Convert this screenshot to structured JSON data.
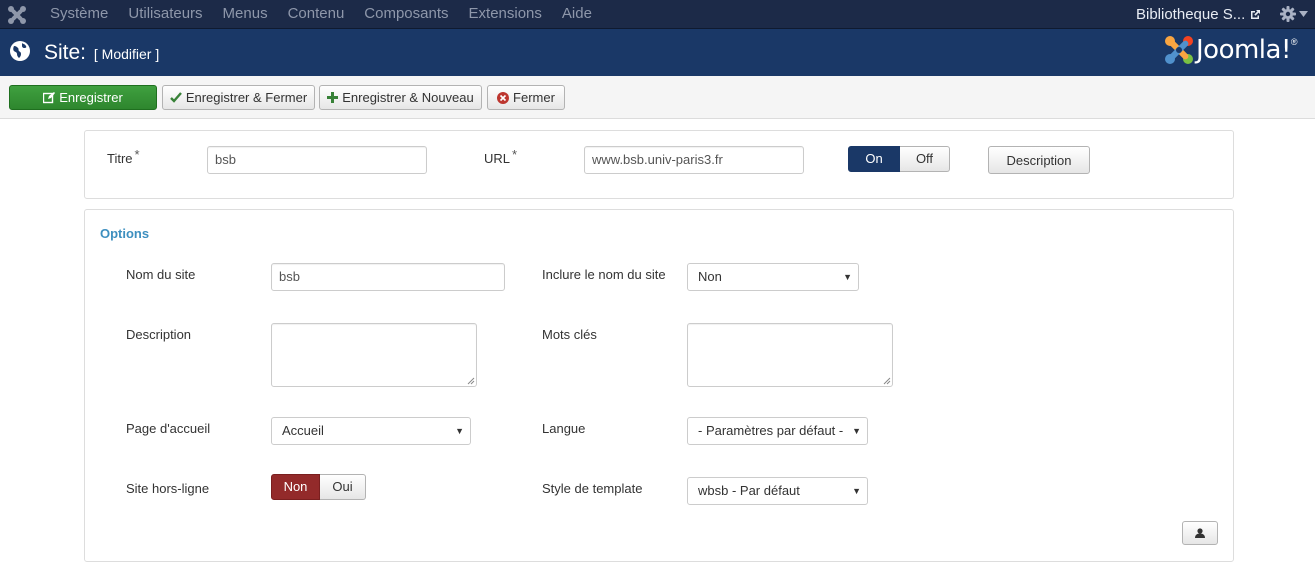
{
  "topbar": {
    "menu": [
      "Système",
      "Utilisateurs",
      "Menus",
      "Contenu",
      "Composants",
      "Extensions",
      "Aide"
    ],
    "site_name": "Bibliotheque S..."
  },
  "header": {
    "title": "Site:",
    "subtitle": "[ Modifier ]",
    "brand": "Joomla!",
    "brand_mark": "®"
  },
  "toolbar": {
    "save_label": "Enregistrer",
    "save_close_label": "Enregistrer & Fermer",
    "save_new_label": "Enregistrer & Nouveau",
    "close_label": "Fermer"
  },
  "details": {
    "title_label": "Titre",
    "title_value": "bsb",
    "url_label": "URL",
    "url_value": "www.bsb.univ-paris3.fr",
    "required_mark": "*",
    "state_on": "On",
    "state_off": "Off",
    "description_button": "Description"
  },
  "options": {
    "legend": "Options",
    "site_name_label": "Nom du site",
    "site_name_value": "bsb",
    "include_name_label": "Inclure le nom du site",
    "include_name_value": "Non",
    "description_label": "Description",
    "keywords_label": "Mots clés",
    "homepage_label": "Page d'accueil",
    "homepage_value": "Accueil",
    "language_label": "Langue",
    "language_value": "- Paramètres par défaut -",
    "offline_label": "Site hors-ligne",
    "offline_no": "Non",
    "offline_yes": "Oui",
    "template_style_label": "Style de template",
    "template_style_value": "wbsb - Par défaut"
  },
  "colors": {
    "nav_bg": "#1c2a48",
    "header_bg": "#1a3867",
    "save_green": "#2e862e",
    "legend_blue": "#3d8fbf",
    "toggle_red": "#932a2a"
  }
}
